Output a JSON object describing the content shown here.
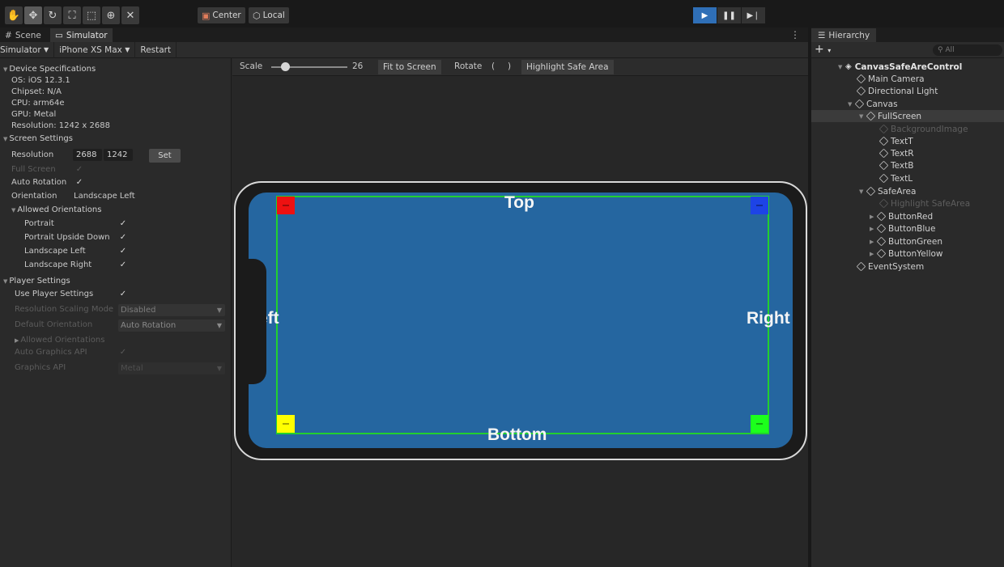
{
  "toolbar": {
    "tools": [
      "hand-icon",
      "move-icon",
      "rotate-icon",
      "scale-icon",
      "rect-icon",
      "transform-icon",
      "custom-tool-icon"
    ],
    "pivot": "Center",
    "space": "Local",
    "play": [
      "play-icon",
      "pause-icon",
      "step-icon"
    ]
  },
  "tabs": {
    "scene": "Scene",
    "simulator": "Simulator"
  },
  "subbar": {
    "mode": "Simulator",
    "device": "iPhone XS Max",
    "restart": "Restart"
  },
  "device_specs": {
    "header": "Device Specifications",
    "os": "OS: iOS 12.3.1",
    "chipset": "Chipset: N/A",
    "cpu": "CPU: arm64e",
    "gpu": "GPU: Metal",
    "resolution": "Resolution: 1242 x 2688"
  },
  "screen_settings": {
    "header": "Screen Settings",
    "resolution_label": "Resolution",
    "res_w": "2688",
    "res_h": "1242",
    "set_label": "Set",
    "full_screen": "Full Screen",
    "auto_rotation": "Auto Rotation",
    "orientation_label": "Orientation",
    "orientation_value": "Landscape Left",
    "allowed_header": "Allowed Orientations",
    "portrait": "Portrait",
    "portrait_upside": "Portrait Upside Down",
    "landscape_left": "Landscape Left",
    "landscape_right": "Landscape Right"
  },
  "player_settings": {
    "header": "Player Settings",
    "use_player": "Use Player Settings",
    "scaling_label": "Resolution Scaling Mode",
    "scaling_value": "Disabled",
    "default_orient_label": "Default Orientation",
    "default_orient_value": "Auto Rotation",
    "allowed_orient": "Allowed Orientations",
    "auto_graphics": "Auto Graphics API",
    "graphics_label": "Graphics API",
    "graphics_value": "Metal"
  },
  "viewport": {
    "scale_label": "Scale",
    "scale_value": "26",
    "fit_label": "Fit to Screen",
    "rotate_label": "Rotate",
    "rotate_left": "(",
    "rotate_right": ")",
    "highlight_label": "Highlight Safe Area"
  },
  "screen_text": {
    "top": "Top",
    "right": "Right",
    "left": "eft",
    "bottom": "Bottom"
  },
  "hierarchy": {
    "tab": "Hierarchy",
    "plus": "+",
    "search_placeholder": "All",
    "items": [
      {
        "label": "CanvasSafeAreControl"
      },
      {
        "label": "Main Camera"
      },
      {
        "label": "Directional Light"
      },
      {
        "label": "Canvas"
      },
      {
        "label": "FullScreen"
      },
      {
        "label": "BackgroundImage"
      },
      {
        "label": "TextT"
      },
      {
        "label": "TextR"
      },
      {
        "label": "TextB"
      },
      {
        "label": "TextL"
      },
      {
        "label": "SafeArea"
      },
      {
        "label": "Highlight SafeArea"
      },
      {
        "label": "ButtonRed"
      },
      {
        "label": "ButtonBlue"
      },
      {
        "label": "ButtonGreen"
      },
      {
        "label": "ButtonYellow"
      },
      {
        "label": "EventSystem"
      }
    ]
  },
  "colors": {
    "accent": "#2f6fb7",
    "screen_blue": "#2566a0",
    "safe_area_green": "#22d02e",
    "button_red": "#ee1111",
    "button_blue": "#1d44e6",
    "button_yellow": "#ffff00",
    "button_green": "#1cff1c"
  }
}
